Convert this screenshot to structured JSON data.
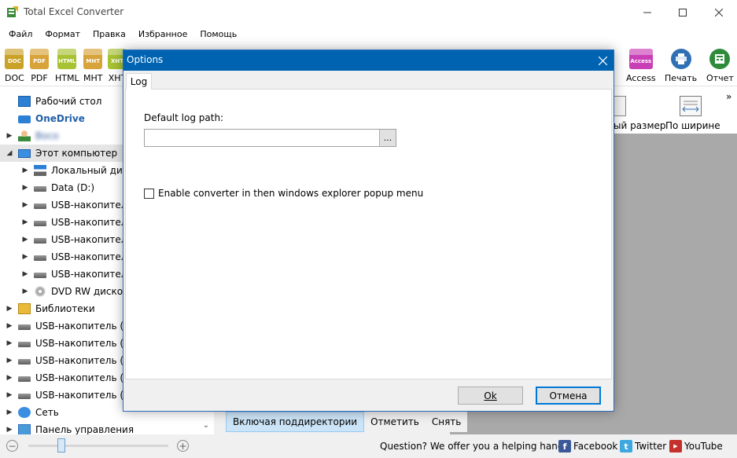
{
  "window": {
    "title": "Total Excel Converter"
  },
  "menu": [
    "Файл",
    "Формат",
    "Правка",
    "Избранное",
    "Помощь"
  ],
  "toolbar": {
    "formats": [
      {
        "label": "DOC",
        "badge": "DOC",
        "color": "#c9a227"
      },
      {
        "label": "PDF",
        "badge": "PDF",
        "color": "#d8a33a"
      },
      {
        "label": "HTML",
        "badge": "HTML",
        "color": "#a7c233"
      },
      {
        "label": "MHT",
        "badge": "MHT",
        "color": "#d8a33a"
      },
      {
        "label": "XHT",
        "badge": "XHT",
        "color": "#a7c233"
      }
    ],
    "access": {
      "label": "Access",
      "badge": "Access",
      "color": "#c93fb5"
    },
    "print_label": "Печать",
    "report_label": "Отчет",
    "page_size_label": "ый размер",
    "fit_width_label": "По ширине"
  },
  "tree": {
    "items": [
      {
        "label": "Рабочий стол",
        "icon": "desktop-icon",
        "arrow": ""
      },
      {
        "label": "OneDrive",
        "icon": "onedrive-icon",
        "arrow": ""
      },
      {
        "label": "Boco",
        "icon": "user-icon",
        "arrow": "▶"
      },
      {
        "label": "Этот компьютер",
        "icon": "computer-icon",
        "arrow": "◢"
      },
      {
        "label": "Локальный дис",
        "icon": "windows-drive-icon",
        "arrow": "▶"
      },
      {
        "label": "Data (D:)",
        "icon": "drive-icon",
        "arrow": "▶"
      },
      {
        "label": "USB-накопител",
        "icon": "drive-icon",
        "arrow": "▶"
      },
      {
        "label": "USB-накопител",
        "icon": "drive-icon",
        "arrow": "▶"
      },
      {
        "label": "USB-накопител",
        "icon": "drive-icon",
        "arrow": "▶"
      },
      {
        "label": "USB-накопител",
        "icon": "drive-icon",
        "arrow": "▶"
      },
      {
        "label": "USB-накопител",
        "icon": "drive-icon",
        "arrow": "▶"
      },
      {
        "label": "DVD RW дисков",
        "icon": "dvd-icon",
        "arrow": "▶"
      },
      {
        "label": "Библиотеки",
        "icon": "library-icon",
        "arrow": "▶"
      },
      {
        "label": "USB-накопитель (E",
        "icon": "drive-icon",
        "arrow": "▶"
      },
      {
        "label": "USB-накопитель (F",
        "icon": "drive-icon",
        "arrow": "▶"
      },
      {
        "label": "USB-накопитель (G",
        "icon": "drive-icon",
        "arrow": "▶"
      },
      {
        "label": "USB-накопитель (H",
        "icon": "drive-icon",
        "arrow": "▶"
      },
      {
        "label": "USB-накопитель (I",
        "icon": "drive-icon",
        "arrow": "▶"
      },
      {
        "label": "Сеть",
        "icon": "network-icon",
        "arrow": "▶"
      },
      {
        "label": "Панель управления",
        "icon": "control-panel-icon",
        "arrow": "▶"
      }
    ]
  },
  "subbar": {
    "include_subdirs": "Включая поддиректории",
    "mark": "Отметить",
    "unmark": "Снять"
  },
  "status": {
    "help_text": "Question? We offer you a helping hand -",
    "facebook": "Facebook",
    "twitter": "Twitter",
    "youtube": "YouTube"
  },
  "dialog": {
    "title": "Options",
    "tab": "Log",
    "log_path_label": "Default log path:",
    "log_path_value": "",
    "browse": "...",
    "checkbox_label": "Enable converter in then windows explorer popup menu",
    "checkbox_checked": false,
    "ok": "Ok",
    "cancel": "Отмена"
  },
  "colors": {
    "accent": "#0063b1",
    "button_focus": "#0078d7",
    "preview_gray": "#a9a9a9"
  }
}
